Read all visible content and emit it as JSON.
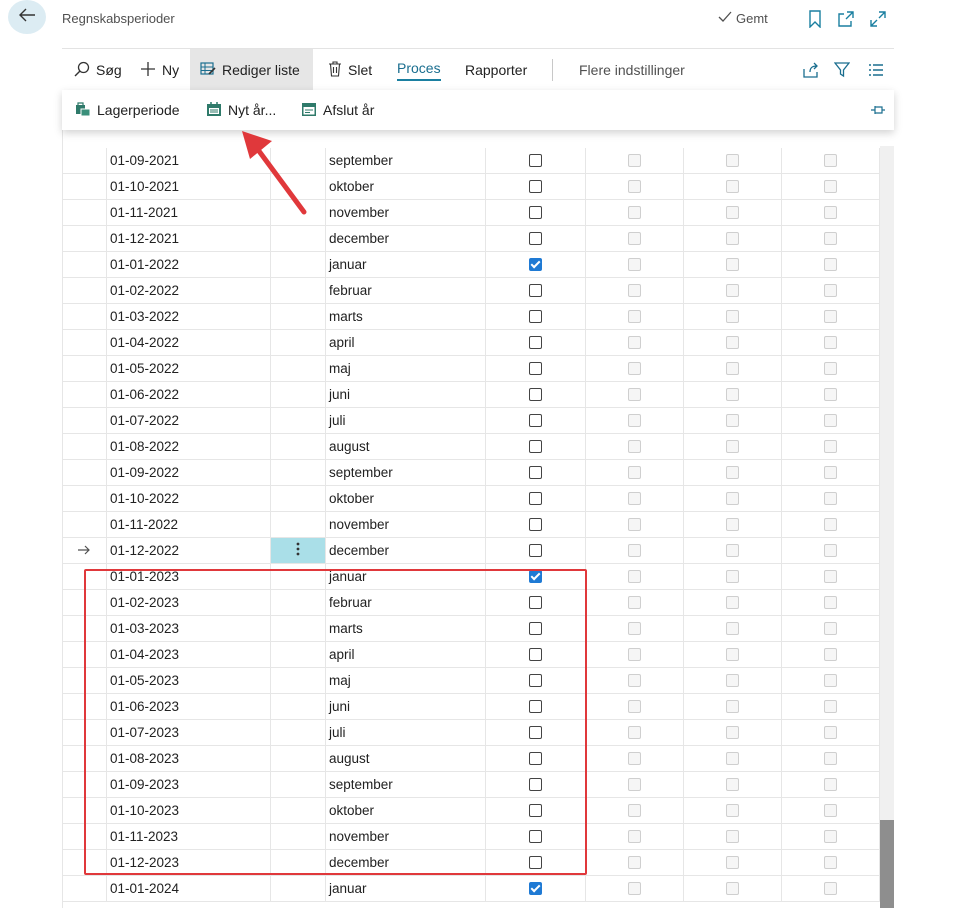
{
  "header": {
    "title": "Regnskabsperioder",
    "saved": "Gemt"
  },
  "actions": {
    "search": "Søg",
    "new": "Ny",
    "edit_list": "Rediger liste",
    "delete": "Slet",
    "process": "Proces",
    "reports": "Rapporter",
    "more": "Flere indstillinger"
  },
  "submenu": {
    "inventory_period": "Lagerperiode",
    "new_year": "Nyt år...",
    "close_year": "Afslut år"
  },
  "rows": [
    {
      "date": "01-09-2021",
      "name": "september",
      "new_fy": false
    },
    {
      "date": "01-10-2021",
      "name": "oktober",
      "new_fy": false
    },
    {
      "date": "01-11-2021",
      "name": "november",
      "new_fy": false
    },
    {
      "date": "01-12-2021",
      "name": "december",
      "new_fy": false
    },
    {
      "date": "01-01-2022",
      "name": "januar",
      "new_fy": true
    },
    {
      "date": "01-02-2022",
      "name": "februar",
      "new_fy": false
    },
    {
      "date": "01-03-2022",
      "name": "marts",
      "new_fy": false
    },
    {
      "date": "01-04-2022",
      "name": "april",
      "new_fy": false
    },
    {
      "date": "01-05-2022",
      "name": "maj",
      "new_fy": false
    },
    {
      "date": "01-06-2022",
      "name": "juni",
      "new_fy": false
    },
    {
      "date": "01-07-2022",
      "name": "juli",
      "new_fy": false
    },
    {
      "date": "01-08-2022",
      "name": "august",
      "new_fy": false
    },
    {
      "date": "01-09-2022",
      "name": "september",
      "new_fy": false
    },
    {
      "date": "01-10-2022",
      "name": "oktober",
      "new_fy": false
    },
    {
      "date": "01-11-2022",
      "name": "november",
      "new_fy": false
    },
    {
      "date": "01-12-2022",
      "name": "december",
      "new_fy": false,
      "current": true
    },
    {
      "date": "01-01-2023",
      "name": "januar",
      "new_fy": true
    },
    {
      "date": "01-02-2023",
      "name": "februar",
      "new_fy": false
    },
    {
      "date": "01-03-2023",
      "name": "marts",
      "new_fy": false
    },
    {
      "date": "01-04-2023",
      "name": "april",
      "new_fy": false
    },
    {
      "date": "01-05-2023",
      "name": "maj",
      "new_fy": false
    },
    {
      "date": "01-06-2023",
      "name": "juni",
      "new_fy": false
    },
    {
      "date": "01-07-2023",
      "name": "juli",
      "new_fy": false
    },
    {
      "date": "01-08-2023",
      "name": "august",
      "new_fy": false
    },
    {
      "date": "01-09-2023",
      "name": "september",
      "new_fy": false
    },
    {
      "date": "01-10-2023",
      "name": "oktober",
      "new_fy": false
    },
    {
      "date": "01-11-2023",
      "name": "november",
      "new_fy": false
    },
    {
      "date": "01-12-2023",
      "name": "december",
      "new_fy": false
    },
    {
      "date": "01-01-2024",
      "name": "januar",
      "new_fy": true
    }
  ],
  "colors": {
    "accent": "#1a7fa0",
    "checkbox_checked": "#1f7ad4",
    "highlight": "#e0383b",
    "selected_cell": "#aadfe8"
  },
  "icons": [
    "back-arrow-icon",
    "checkmark-icon",
    "bookmark-icon",
    "open-new-icon",
    "expand-icon",
    "search-icon",
    "plus-icon",
    "edit-list-icon",
    "trash-icon",
    "share-icon",
    "filter-icon",
    "list-icon",
    "inventory-icon",
    "new-year-icon",
    "close-year-icon",
    "pin-icon",
    "row-arrow-icon",
    "more-dots-icon"
  ]
}
